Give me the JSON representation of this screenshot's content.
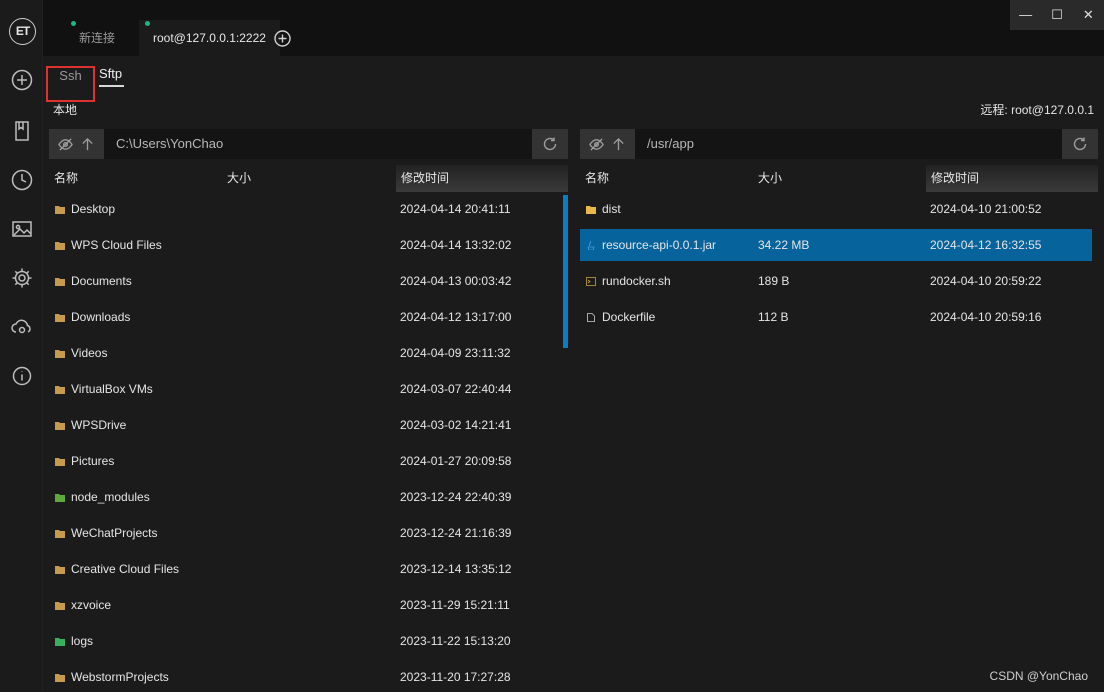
{
  "app": {
    "logo_text": "ET"
  },
  "tabs": [
    {
      "label": "新连接"
    },
    {
      "label": "root@127.0.0.1:2222"
    }
  ],
  "window": {
    "minimize": "—",
    "maximize": "☐",
    "close": "✕"
  },
  "subtabs": {
    "ssh": "Ssh",
    "sftp": "Sftp"
  },
  "local": {
    "label": "本地",
    "path": "C:\\Users\\YonChao",
    "headers": {
      "name": "名称",
      "size": "大小",
      "mtime": "修改时间"
    },
    "rows": [
      {
        "name": "Desktop",
        "size": "",
        "mtime": "2024-04-14 20:41:11",
        "type": "folder"
      },
      {
        "name": "WPS Cloud Files",
        "size": "",
        "mtime": "2024-04-14 13:32:02",
        "type": "folder"
      },
      {
        "name": "Documents",
        "size": "",
        "mtime": "2024-04-13 00:03:42",
        "type": "folder"
      },
      {
        "name": "Downloads",
        "size": "",
        "mtime": "2024-04-12 13:17:00",
        "type": "folder"
      },
      {
        "name": "Videos",
        "size": "",
        "mtime": "2024-04-09 23:11:32",
        "type": "folder"
      },
      {
        "name": "VirtualBox VMs",
        "size": "",
        "mtime": "2024-03-07 22:40:44",
        "type": "folder"
      },
      {
        "name": "WPSDrive",
        "size": "",
        "mtime": "2024-03-02 14:21:41",
        "type": "folder"
      },
      {
        "name": "Pictures",
        "size": "",
        "mtime": "2024-01-27 20:09:58",
        "type": "folder"
      },
      {
        "name": "node_modules",
        "size": "",
        "mtime": "2023-12-24 22:40:39",
        "type": "node-folder"
      },
      {
        "name": "WeChatProjects",
        "size": "",
        "mtime": "2023-12-24 21:16:39",
        "type": "folder"
      },
      {
        "name": "Creative Cloud Files",
        "size": "",
        "mtime": "2023-12-14 13:35:12",
        "type": "folder"
      },
      {
        "name": "xzvoice",
        "size": "",
        "mtime": "2023-11-29 15:21:11",
        "type": "folder"
      },
      {
        "name": "logs",
        "size": "",
        "mtime": "2023-11-22 15:13:20",
        "type": "logs-folder"
      },
      {
        "name": "WebstormProjects",
        "size": "",
        "mtime": "2023-11-20 17:27:28",
        "type": "folder"
      }
    ]
  },
  "remote": {
    "label": "远程: root@127.0.0.1",
    "path": "/usr/app",
    "headers": {
      "name": "名称",
      "size": "大小",
      "mtime": "修改时间"
    },
    "rows": [
      {
        "name": "dist",
        "size": "",
        "mtime": "2024-04-10 21:00:52",
        "type": "folder-yellow"
      },
      {
        "name": "resource-api-0.0.1.jar",
        "size": "34.22 MB",
        "mtime": "2024-04-12 16:32:55",
        "type": "jar",
        "selected": true
      },
      {
        "name": "rundocker.sh",
        "size": "189 B",
        "mtime": "2024-04-10 20:59:22",
        "type": "shell"
      },
      {
        "name": "Dockerfile",
        "size": "112 B",
        "mtime": "2024-04-10 20:59:16",
        "type": "file"
      }
    ]
  },
  "watermark": "CSDN @YonChao",
  "colors": {
    "accent": "#06639c",
    "scrollbar": "#0a7ec4",
    "status_dot": "#1db58a",
    "highlight_box": "#e03030"
  }
}
